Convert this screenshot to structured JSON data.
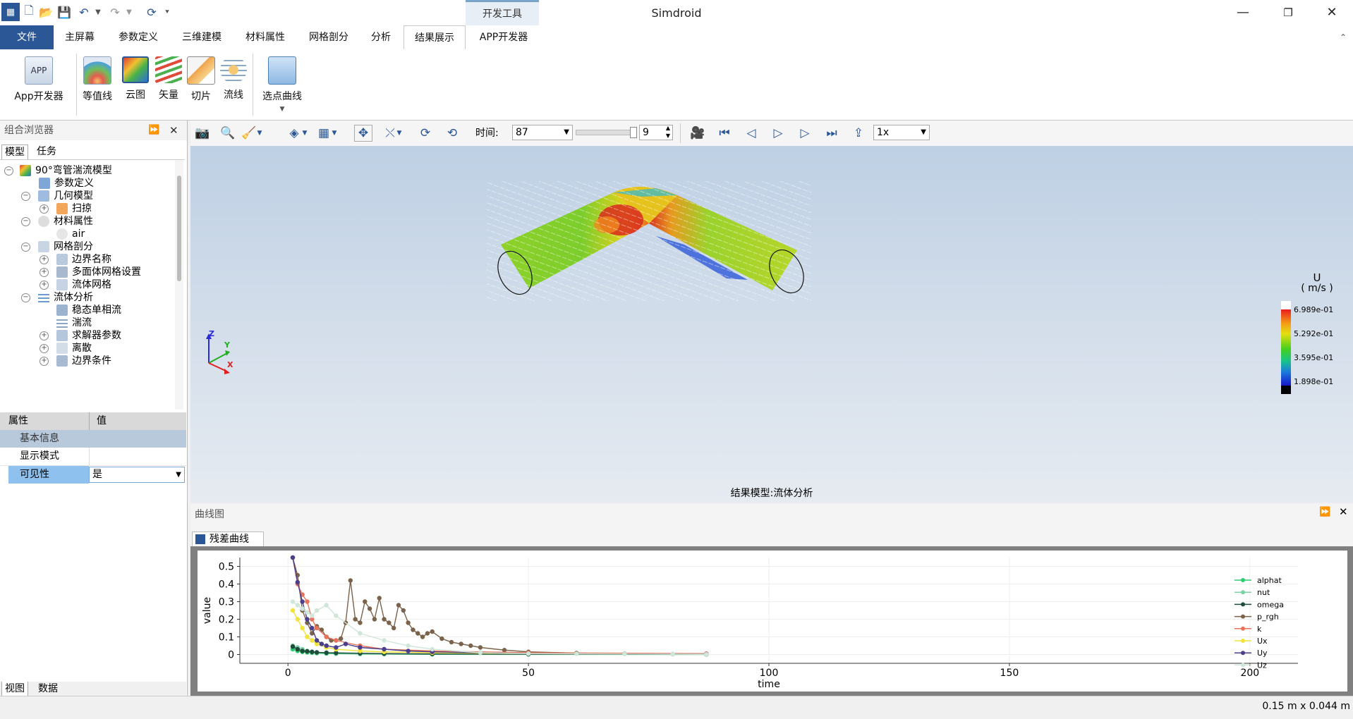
{
  "app": {
    "title": "Simdroid",
    "context_tab": "开发工具"
  },
  "menu": {
    "file": "文件",
    "tabs": [
      "主屏幕",
      "参数定义",
      "三维建模",
      "材料属性",
      "网格剖分",
      "分析",
      "结果展示",
      "APP开发器"
    ]
  },
  "ribbon": {
    "app_dev": "App开发器",
    "contour": "等值线",
    "cloud": "云图",
    "vector": "矢量",
    "slice": "切片",
    "streamline": "流线",
    "point_curve": "选点曲线"
  },
  "browser": {
    "title": "组合浏览器",
    "tab_model": "模型",
    "tab_task": "任务",
    "tree": [
      "90°弯管湍流模型",
      "参数定义",
      "几何模型",
      "扫掠",
      "材料属性",
      "air",
      "网格剖分",
      "边界名称",
      "多面体网格设置",
      "流体网格",
      "流体分析",
      "稳态单相流",
      "湍流",
      "求解器参数",
      "离散",
      "边界条件"
    ]
  },
  "properties": {
    "col_prop": "属性",
    "col_val": "值",
    "group": "基本信息",
    "display_mode": "显示模式",
    "visibility": "可见性",
    "visibility_value": "是"
  },
  "bottom_tabs": {
    "view": "视图",
    "data": "数据"
  },
  "viewport_toolbar": {
    "time_label": "时间:",
    "time_value": "87",
    "step_value": "9",
    "speed_value": "1x"
  },
  "viewport": {
    "caption": "结果模型:流体分析",
    "triad": {
      "x": "X",
      "y": "Y",
      "z": "Z"
    },
    "legend": {
      "title": "U",
      "unit": "( m/s )",
      "labels": [
        "6.989e-01",
        "5.292e-01",
        "3.595e-01",
        "1.898e-01"
      ]
    },
    "colors": {
      "bg_top": "#bed0e4",
      "bg_bottom": "#e6ebf1"
    }
  },
  "chart_panel": {
    "title": "曲线图",
    "tab": "残差曲线"
  },
  "chart_data": {
    "type": "line",
    "xlabel": "time",
    "ylabel": "value",
    "x_ticks": [
      "0",
      "50",
      "100",
      "150",
      "200"
    ],
    "y_ticks": [
      "0",
      "0.1",
      "0.2",
      "0.3",
      "0.4",
      "0.5"
    ],
    "xlim": [
      -10,
      210
    ],
    "ylim": [
      -0.05,
      0.55
    ],
    "grid": true,
    "legend_position": "right",
    "series": [
      {
        "name": "alphat",
        "color": "#2ecc71",
        "x": [
          1,
          2,
          3,
          4,
          5,
          6,
          8,
          10,
          15,
          20,
          30,
          50,
          87
        ],
        "y": [
          0.03,
          0.02,
          0.015,
          0.012,
          0.01,
          0.008,
          0.006,
          0.005,
          0.003,
          0.002,
          0.001,
          0.0005,
          0.0002
        ]
      },
      {
        "name": "nut",
        "color": "#7fd1a6",
        "x": [
          1,
          2,
          3,
          4,
          5,
          6,
          8,
          10,
          15,
          20,
          30,
          50,
          87
        ],
        "y": [
          0.05,
          0.04,
          0.03,
          0.02,
          0.015,
          0.012,
          0.01,
          0.008,
          0.005,
          0.003,
          0.002,
          0.001,
          0.0005
        ]
      },
      {
        "name": "omega",
        "color": "#1e4d3c",
        "x": [
          1,
          2,
          3,
          4,
          5,
          6,
          8,
          10,
          15,
          20,
          30,
          50,
          87
        ],
        "y": [
          0.045,
          0.03,
          0.02,
          0.018,
          0.015,
          0.012,
          0.01,
          0.009,
          0.007,
          0.005,
          0.003,
          0.002,
          0.001
        ]
      },
      {
        "name": "p_rgh",
        "color": "#7a634a",
        "x": [
          1,
          2,
          3,
          4,
          5,
          6,
          7,
          8,
          9,
          10,
          11,
          12,
          13,
          14,
          15,
          16,
          17,
          18,
          19,
          20,
          21,
          22,
          23,
          24,
          25,
          26,
          27,
          28,
          29,
          30,
          32,
          34,
          36,
          38,
          40,
          45,
          50,
          60,
          70,
          80,
          87
        ],
        "y": [
          0.55,
          0.45,
          0.25,
          0.18,
          0.12,
          0.16,
          0.14,
          0.1,
          0.08,
          0.08,
          0.09,
          0.18,
          0.42,
          0.2,
          0.18,
          0.3,
          0.26,
          0.2,
          0.32,
          0.2,
          0.18,
          0.15,
          0.28,
          0.25,
          0.18,
          0.14,
          0.12,
          0.1,
          0.12,
          0.13,
          0.09,
          0.07,
          0.06,
          0.05,
          0.04,
          0.025,
          0.015,
          0.008,
          0.004,
          0.002,
          0.001
        ]
      },
      {
        "name": "k",
        "color": "#e8735a",
        "x": [
          1,
          2,
          3,
          4,
          5,
          6,
          8,
          10,
          15,
          20,
          30,
          50,
          87
        ],
        "y": [
          0.55,
          0.4,
          0.34,
          0.3,
          0.2,
          0.15,
          0.1,
          0.08,
          0.05,
          0.03,
          0.02,
          0.01,
          0.005
        ]
      },
      {
        "name": "Ux",
        "color": "#f1e33b",
        "x": [
          1,
          2,
          3,
          4,
          5,
          6,
          8,
          10,
          15,
          20,
          30,
          50,
          87
        ],
        "y": [
          0.25,
          0.2,
          0.15,
          0.1,
          0.08,
          0.06,
          0.04,
          0.03,
          0.02,
          0.015,
          0.01,
          0.005,
          0.002
        ]
      },
      {
        "name": "Uy",
        "color": "#4b3f8c",
        "x": [
          1,
          2,
          3,
          4,
          5,
          6,
          7,
          8,
          10,
          12,
          15,
          20,
          25,
          30,
          40,
          50,
          87
        ],
        "y": [
          0.55,
          0.41,
          0.3,
          0.2,
          0.15,
          0.08,
          0.06,
          0.05,
          0.04,
          0.06,
          0.04,
          0.03,
          0.02,
          0.015,
          0.01,
          0.005,
          0.002
        ]
      },
      {
        "name": "Uz",
        "color": "#cfe6d9",
        "x": [
          1,
          2,
          3,
          4,
          5,
          6,
          8,
          10,
          15,
          20,
          25,
          30,
          40,
          50,
          60,
          70,
          80,
          87
        ],
        "y": [
          0.3,
          0.28,
          0.26,
          0.24,
          0.22,
          0.25,
          0.28,
          0.22,
          0.12,
          0.08,
          0.05,
          0.03,
          0.01,
          0.005,
          0.004,
          0.003,
          0.002,
          0.001
        ]
      }
    ]
  },
  "status": {
    "dimensions": "0.15 m x 0.044 m"
  }
}
